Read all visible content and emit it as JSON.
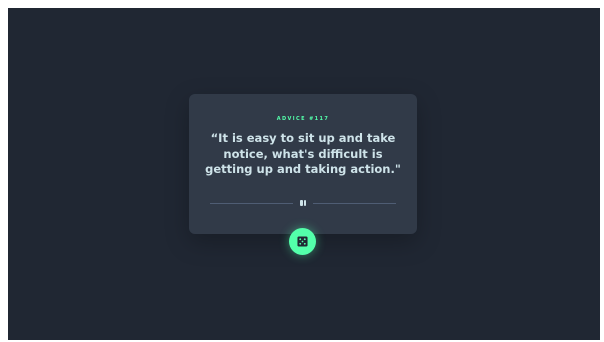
{
  "advice": {
    "label": "ADVICE #117",
    "quote": "“It is easy to sit up and take notice, what's difficult is getting up and taking action.\""
  },
  "icons": {
    "divider": "pause-icon",
    "button": "dice-icon"
  },
  "colors": {
    "page_bg": "#202733",
    "card_bg": "#313a48",
    "accent": "#53ffaa",
    "text": "#cee3e9",
    "divider": "#4f5d74"
  }
}
